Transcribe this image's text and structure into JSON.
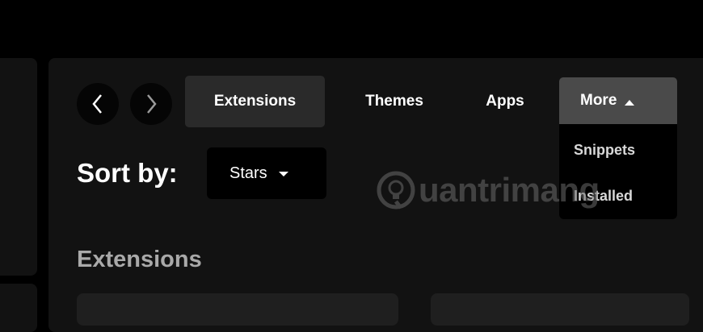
{
  "nav": {
    "back_icon": "chevron-left-icon",
    "forward_icon": "chevron-right-icon"
  },
  "tabs": [
    {
      "label": "Extensions",
      "active": true
    },
    {
      "label": "Themes",
      "active": false
    },
    {
      "label": "Apps",
      "active": false
    },
    {
      "label": "More",
      "active": false,
      "open": true
    }
  ],
  "more_menu": {
    "items": [
      "Snippets",
      "Installed"
    ]
  },
  "sort": {
    "label": "Sort by:",
    "selected": "Stars"
  },
  "section": {
    "heading": "Extensions"
  },
  "watermark": {
    "text": "uantrimang"
  },
  "colors": {
    "background": "#000000",
    "panel": "#121212",
    "active_tab": "#2a2a2a",
    "more_tab": "#4a4a4a"
  }
}
